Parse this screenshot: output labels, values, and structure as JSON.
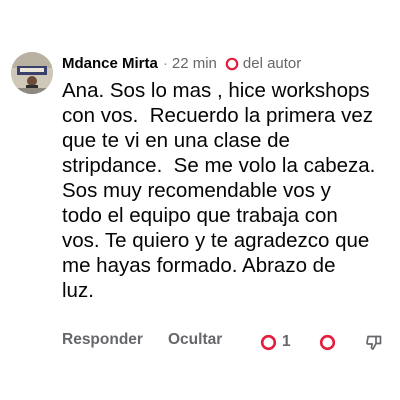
{
  "comment": {
    "author": "Mdance Mirta",
    "separator": "·",
    "timestamp": "22 min",
    "author_badge": {
      "label": "del autor",
      "icon": "heart-outline-icon"
    },
    "text_lines": [
      "Ana. Sos lo mas , hice workshops",
      "con vos.  Recuerdo la primera vez",
      "que te vi en una clase de",
      "stripdance.  Se me volo la cabeza.",
      "Sos muy recomendable vos y",
      "todo el equipo que trabaja con",
      "vos. Te quiero y te agradezco que",
      "me hayas formado. Abrazo de",
      "luz."
    ],
    "actions": {
      "reply_label": "Responder",
      "hide_label": "Ocultar",
      "like_count": "1",
      "like_icon": "heart-outline-icon",
      "react_icon": "heart-outline-icon",
      "dislike_icon": "thumbs-down-icon"
    },
    "colors": {
      "accent_red": "#e41e3f",
      "secondary_text": "#65676b",
      "primary_text": "#050505"
    }
  }
}
